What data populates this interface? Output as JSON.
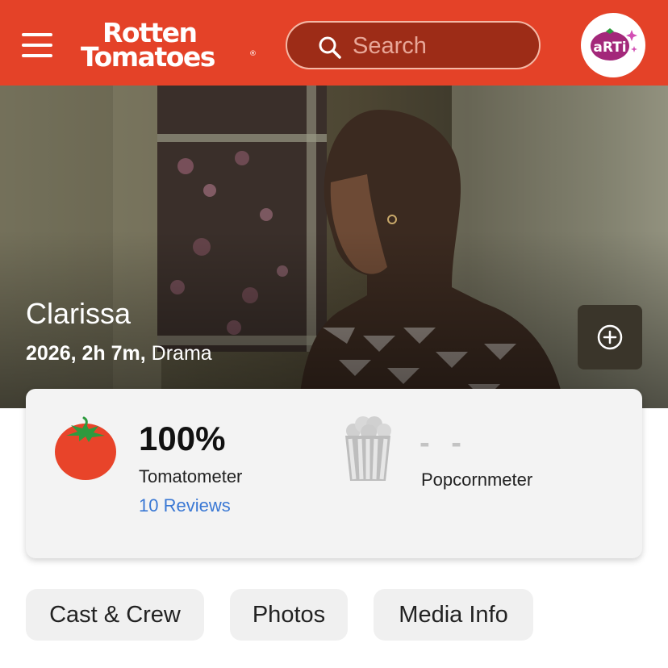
{
  "header": {
    "logo_line1": "Rotten",
    "logo_line2": "Tomatoes",
    "logo_mark": "®",
    "search_placeholder": "Search",
    "avatar_text": "aRTi",
    "brand_color": "#e44228"
  },
  "hero": {
    "title": "Clarissa",
    "year_runtime": "2026, 2h 7m,",
    "genre": "Drama",
    "watchlist_icon": "plus-circle-icon"
  },
  "scores": {
    "tomatometer": {
      "value": "100%",
      "label": "Tomatometer",
      "reviews": "10 Reviews",
      "icon": "fresh-tomato-icon"
    },
    "popcornmeter": {
      "value": "- -",
      "label": "Popcornmeter",
      "icon": "popcorn-bucket-icon"
    }
  },
  "tabs": [
    {
      "label": "Cast & Crew"
    },
    {
      "label": "Photos"
    },
    {
      "label": "Media Info"
    }
  ]
}
